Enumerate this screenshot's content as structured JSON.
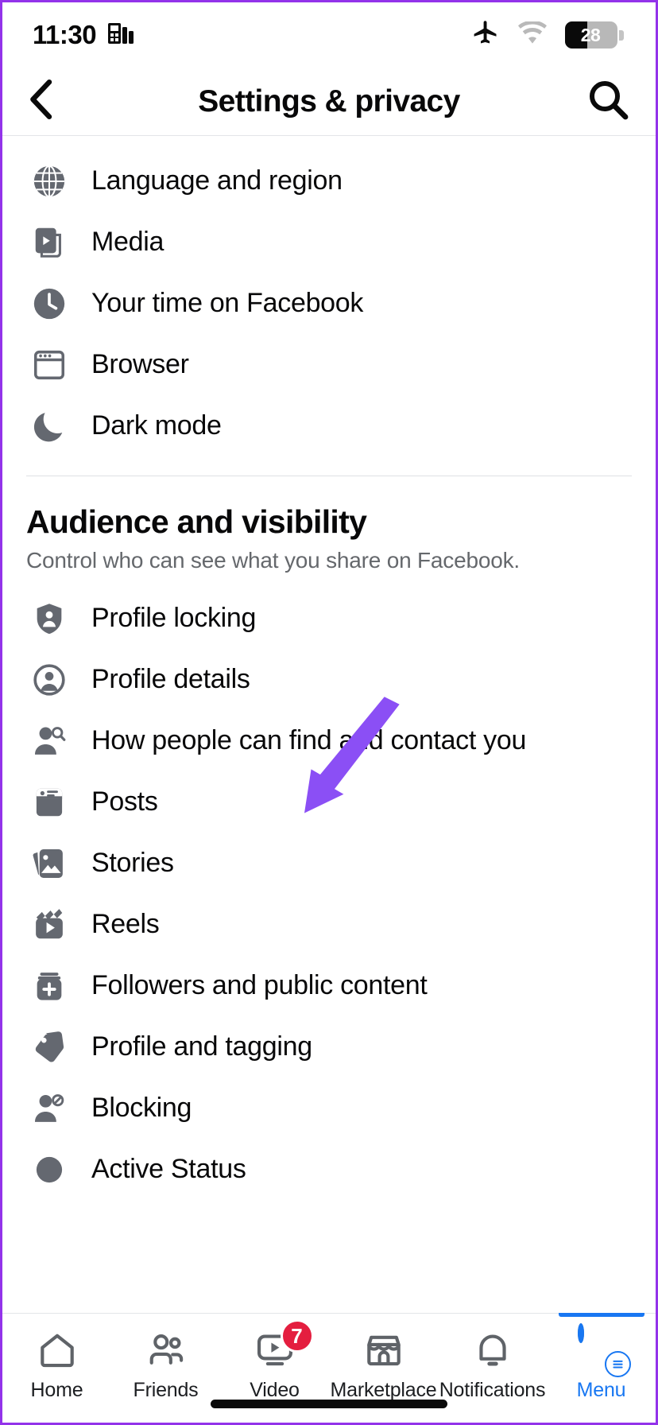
{
  "status_bar": {
    "time": "11:30",
    "sim_icon": "sim-card-icon",
    "airplane_icon": "airplane-mode-icon",
    "wifi_icon": "wifi-icon",
    "battery_percent": "28",
    "battery_icon": "battery-icon"
  },
  "header": {
    "back_icon": "back-chevron-icon",
    "title": "Settings & privacy",
    "search_icon": "search-icon"
  },
  "top_group": {
    "items": [
      {
        "label": "Language and region",
        "icon": "globe-icon"
      },
      {
        "label": "Media",
        "icon": "media-play-icon"
      },
      {
        "label": "Your time on Facebook",
        "icon": "clock-icon"
      },
      {
        "label": "Browser",
        "icon": "browser-window-icon"
      },
      {
        "label": "Dark mode",
        "icon": "moon-icon"
      }
    ]
  },
  "audience_section": {
    "title": "Audience and visibility",
    "subtitle": "Control who can see what you share on Facebook.",
    "items": [
      {
        "label": "Profile locking",
        "icon": "shield-person-icon"
      },
      {
        "label": "Profile details",
        "icon": "profile-circle-icon"
      },
      {
        "label": "How people can find and contact you",
        "icon": "person-search-icon"
      },
      {
        "label": "Posts",
        "icon": "posts-card-icon"
      },
      {
        "label": "Stories",
        "icon": "stories-photo-icon"
      },
      {
        "label": "Reels",
        "icon": "reels-clapper-icon"
      },
      {
        "label": "Followers and public content",
        "icon": "followers-add-icon"
      },
      {
        "label": "Profile and tagging",
        "icon": "tag-icon"
      },
      {
        "label": "Blocking",
        "icon": "person-blocked-icon"
      },
      {
        "label": "Active Status",
        "icon": "active-status-icon"
      }
    ]
  },
  "annotation": {
    "arrow_color": "#8b4ff5",
    "points_to": "How people can find and contact you"
  },
  "bottom_nav": {
    "active_tab": "Menu",
    "active_color": "#1877f2",
    "badge_color": "#e41e3f",
    "tabs": [
      {
        "label": "Home",
        "icon": "home-icon",
        "badge": ""
      },
      {
        "label": "Friends",
        "icon": "friends-icon",
        "badge": ""
      },
      {
        "label": "Video",
        "icon": "video-icon",
        "badge": "7"
      },
      {
        "label": "Marketplace",
        "icon": "marketplace-store-icon",
        "badge": ""
      },
      {
        "label": "Notifications",
        "icon": "bell-icon",
        "badge": ""
      },
      {
        "label": "Menu",
        "icon": "avatar-menu-icon",
        "badge": ""
      }
    ]
  }
}
